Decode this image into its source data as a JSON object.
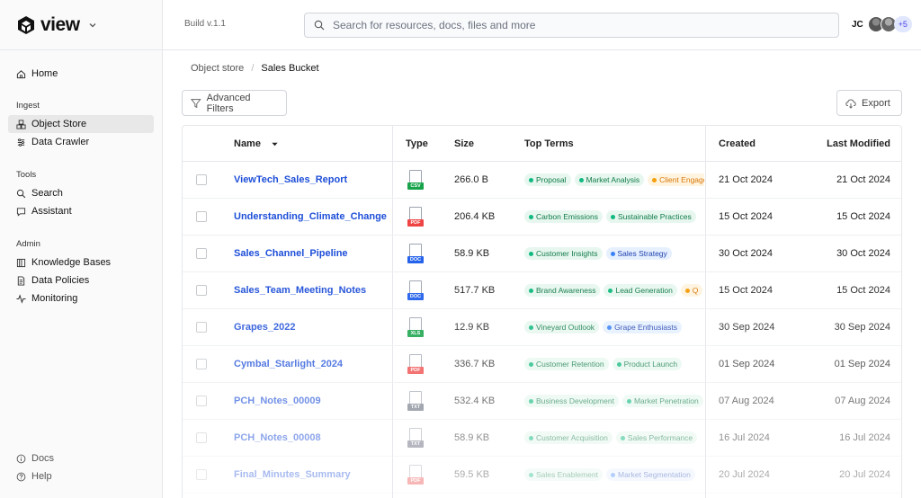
{
  "app": {
    "name": "view",
    "build": "Build v.1.1"
  },
  "sidebar": {
    "home": "Home",
    "sections": {
      "ingest": "Ingest",
      "tools": "Tools",
      "admin": "Admin"
    },
    "ingest_items": [
      "Object Store",
      "Data Crawler"
    ],
    "tools_items": [
      "Search",
      "Assistant"
    ],
    "admin_items": [
      "Knowledge Bases",
      "Data Policies",
      "Monitoring"
    ],
    "bottom_items": [
      "Docs",
      "Help"
    ],
    "active_item": "Object Store"
  },
  "header": {
    "search_placeholder": "Search for resources, docs, files and more",
    "user_initials": "JC",
    "more_users": "+5"
  },
  "breadcrumb": {
    "root": "Object store",
    "current": "Sales Bucket"
  },
  "toolbar": {
    "filters_label": "Advanced Filters",
    "export_label": "Export"
  },
  "table": {
    "columns": [
      "Name",
      "Type",
      "Size",
      "Top Terms",
      "Created",
      "Last Modified"
    ],
    "rows": [
      {
        "name": "ViewTech_Sales_Report",
        "type": "CSV",
        "size": "266.0 B",
        "terms": [
          {
            "t": "Proposal",
            "c": "green"
          },
          {
            "t": "Market Analysis",
            "c": "green"
          },
          {
            "t": "Client Engagement",
            "c": "orange"
          }
        ],
        "created": "21 Oct 2024",
        "modified": "21 Oct 2024"
      },
      {
        "name": "Understanding_Climate_Change",
        "type": "PDF",
        "size": "206.4 KB",
        "terms": [
          {
            "t": "Carbon Emissions",
            "c": "green"
          },
          {
            "t": "Sustainable Practices",
            "c": "green"
          }
        ],
        "created": "15 Oct 2024",
        "modified": "15 Oct 2024"
      },
      {
        "name": "Sales_Channel_Pipeline",
        "type": "DOC",
        "size": "58.9 KB",
        "terms": [
          {
            "t": "Customer Insights",
            "c": "green"
          },
          {
            "t": "Sales Strategy",
            "c": "blue"
          }
        ],
        "created": "30 Oct 2024",
        "modified": "30 Oct 2024"
      },
      {
        "name": "Sales_Team_Meeting_Notes",
        "type": "DOC",
        "size": "517.7 KB",
        "terms": [
          {
            "t": "Brand Awareness",
            "c": "green"
          },
          {
            "t": "Lead Generation",
            "c": "green"
          },
          {
            "t": "Q",
            "c": "orange"
          }
        ],
        "created": "15 Oct 2024",
        "modified": "15 Oct 2024"
      },
      {
        "name": "Grapes_2022",
        "type": "XLS",
        "size": "12.9 KB",
        "terms": [
          {
            "t": "Vineyard Outlook",
            "c": "green"
          },
          {
            "t": "Grape Enthusiasts",
            "c": "blue"
          }
        ],
        "created": "30 Sep 2024",
        "modified": "30 Sep 2024"
      },
      {
        "name": "Cymbal_Starlight_2024",
        "type": "PDF",
        "size": "336.7 KB",
        "terms": [
          {
            "t": "Customer Retention",
            "c": "green"
          },
          {
            "t": "Product Launch",
            "c": "green"
          }
        ],
        "created": "01 Sep 2024",
        "modified": "01 Sep 2024"
      },
      {
        "name": "PCH_Notes_00009",
        "type": "TXT",
        "size": "532.4 KB",
        "terms": [
          {
            "t": "Business Development",
            "c": "green"
          },
          {
            "t": "Market Penetration",
            "c": "green"
          }
        ],
        "created": "07 Aug 2024",
        "modified": "07 Aug 2024"
      },
      {
        "name": "PCH_Notes_00008",
        "type": "TXT",
        "size": "58.9 KB",
        "terms": [
          {
            "t": "Customer Acquisition",
            "c": "green"
          },
          {
            "t": "Sales Performance",
            "c": "green"
          }
        ],
        "created": "16 Jul 2024",
        "modified": "16 Jul 2024"
      },
      {
        "name": "Final_Minutes_Summary",
        "type": "PDF",
        "size": "59.5 KB",
        "terms": [
          {
            "t": "Sales Enablement",
            "c": "green"
          },
          {
            "t": "Market Segmentation",
            "c": "blue"
          }
        ],
        "created": "20 Jul 2024",
        "modified": "20 Jul 2024"
      }
    ]
  },
  "colors": {
    "accent": "#1d4ed8",
    "csv": "#16a34a",
    "pdf": "#ef4444",
    "doc": "#2563eb",
    "xls": "#16a34a",
    "txt": "#6b7280"
  }
}
